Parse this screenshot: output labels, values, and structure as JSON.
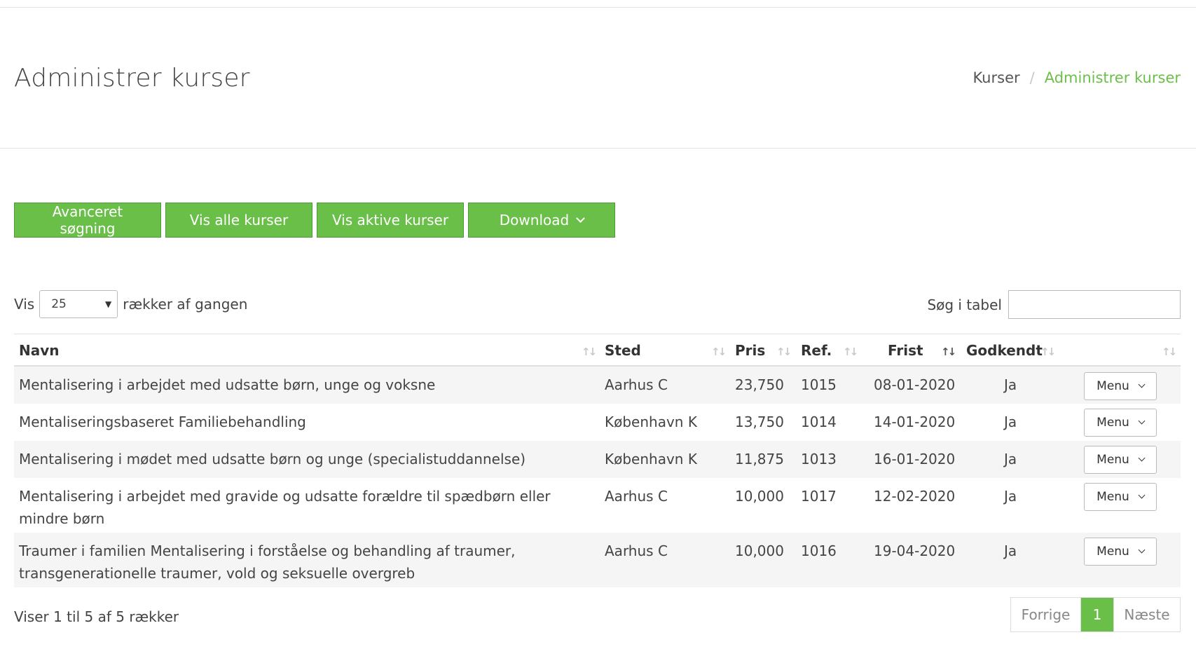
{
  "page": {
    "title": "Administrer kurser",
    "breadcrumb": {
      "root": "Kurser",
      "separator": "/",
      "current": "Administrer kurser"
    }
  },
  "toolbar": {
    "advanced_search": "Avanceret søgning",
    "show_all": "Vis alle kurser",
    "show_active": "Vis aktive kurser",
    "download": "Download"
  },
  "length": {
    "prefix": "Vis",
    "value": "25",
    "suffix": "rækker af gangen"
  },
  "search": {
    "label": "Søg i tabel",
    "value": ""
  },
  "table": {
    "columns": [
      "Navn",
      "Sted",
      "Pris",
      "Ref.",
      "Frist",
      "Godkendt"
    ],
    "sorted_column": "Frist",
    "rows": [
      {
        "navn": "Mentalisering i arbejdet med udsatte børn, unge og voksne",
        "sted": "Aarhus C",
        "pris": "23,750",
        "ref": "1015",
        "frist": "08-01-2020",
        "godkendt": "Ja",
        "menu": "Menu"
      },
      {
        "navn": "Mentaliseringsbaseret Familiebehandling",
        "sted": "København K",
        "pris": "13,750",
        "ref": "1014",
        "frist": "14-01-2020",
        "godkendt": "Ja",
        "menu": "Menu"
      },
      {
        "navn": "Mentalisering i mødet med udsatte børn og unge (specialistuddannelse)",
        "sted": "København K",
        "pris": "11,875",
        "ref": "1013",
        "frist": "16-01-2020",
        "godkendt": "Ja",
        "menu": "Menu"
      },
      {
        "navn": "Mentalisering i arbejdet med gravide og udsatte forældre til spædbørn eller mindre børn",
        "sted": "Aarhus C",
        "pris": "10,000",
        "ref": "1017",
        "frist": "12-02-2020",
        "godkendt": "Ja",
        "menu": "Menu"
      },
      {
        "navn": "Traumer i familien Mentalisering i forståelse og behandling af traumer, transgenerationelle traumer, vold og seksuelle overgreb",
        "sted": "Aarhus C",
        "pris": "10,000",
        "ref": "1016",
        "frist": "19-04-2020",
        "godkendt": "Ja",
        "menu": "Menu"
      }
    ]
  },
  "footer": {
    "info": "Viser 1 til 5 af 5 rækker",
    "pagination": {
      "prev": "Forrige",
      "current": "1",
      "next": "Næste"
    }
  },
  "colors": {
    "accent": "#6abf49",
    "accent_border": "#4e9a36",
    "breadcrumb_current": "#6cbf4a"
  },
  "icons": {
    "dropdown": "chevron-down-icon",
    "sort": "sort-icon",
    "select_arrow": "caret-down-icon"
  }
}
